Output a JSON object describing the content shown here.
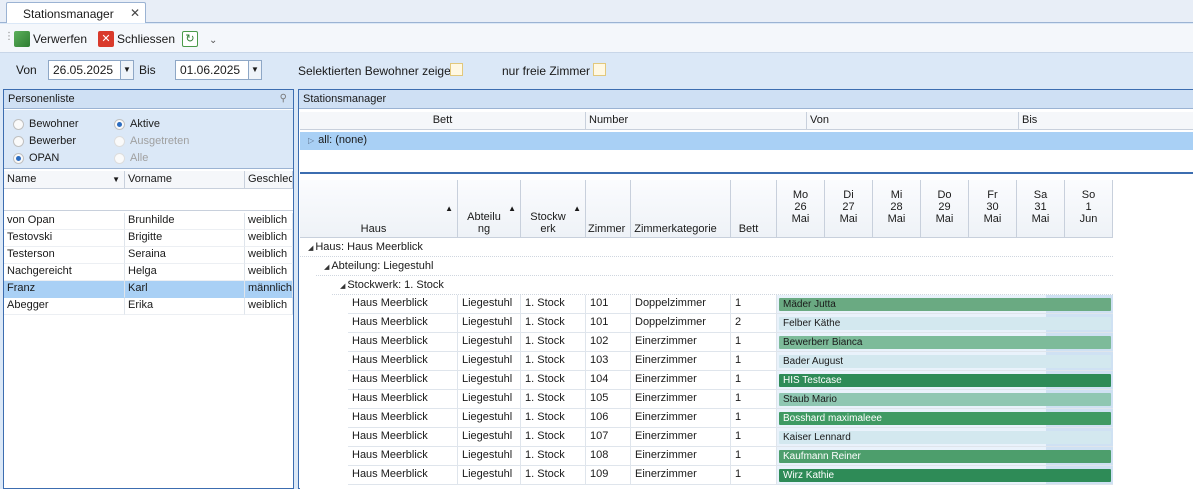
{
  "tab": {
    "title": "Stationsmanager",
    "close": "✕"
  },
  "toolbar": {
    "discard_label": "Verwerfen",
    "close_label": "Schliessen",
    "overflow": "⌄"
  },
  "filter": {
    "from_label": "Von",
    "from_value": "26.05.2025",
    "to_label": "Bis",
    "to_value": "01.06.2025",
    "selected_label": "Selektierten Bewohner zeigen",
    "free_rooms_label": "nur freie Zimmer"
  },
  "person_panel": {
    "title": "Personenliste",
    "radios": [
      {
        "label": "Bewohner",
        "selected": false,
        "enabled": true
      },
      {
        "label": "Bewerber",
        "selected": false,
        "enabled": true
      },
      {
        "label": "OPAN",
        "selected": true,
        "enabled": true
      },
      {
        "label": "Aktive",
        "selected": true,
        "enabled": true
      },
      {
        "label": "Ausgetreten",
        "selected": false,
        "enabled": false
      },
      {
        "label": "Alle",
        "selected": false,
        "enabled": false
      }
    ],
    "columns": [
      "Name",
      "Vorname",
      "Geschlec"
    ],
    "rows": [
      {
        "name": "von Opan",
        "vorname": "Brunhilde",
        "geschlecht": "weiblich"
      },
      {
        "name": "Testovski",
        "vorname": "Brigitte",
        "geschlecht": "weiblich"
      },
      {
        "name": "Testerson",
        "vorname": "Seraina",
        "geschlecht": "weiblich"
      },
      {
        "name": "Nachgereicht",
        "vorname": "Helga",
        "geschlecht": "weiblich"
      },
      {
        "name": "Franz",
        "vorname": "Karl",
        "geschlecht": "männlich"
      },
      {
        "name": "Abegger",
        "vorname": "Erika",
        "geschlecht": "weiblich"
      }
    ],
    "selected_index": 4
  },
  "station_panel": {
    "title": "Stationsmanager",
    "top_columns": [
      "Bett",
      "Number",
      "Von",
      "Bis"
    ],
    "top_group": "all:  (none)",
    "grid_columns": [
      "Haus",
      "Abteilu ng",
      "Stockw erk",
      "Zimmer",
      "Zimmerkategorie",
      "Bett"
    ],
    "days": [
      {
        "dow": "Mo",
        "day": "26",
        "mon": "Mai"
      },
      {
        "dow": "Di",
        "day": "27",
        "mon": "Mai"
      },
      {
        "dow": "Mi",
        "day": "28",
        "mon": "Mai"
      },
      {
        "dow": "Do",
        "day": "29",
        "mon": "Mai"
      },
      {
        "dow": "Fr",
        "day": "30",
        "mon": "Mai"
      },
      {
        "dow": "Sa",
        "day": "31",
        "mon": "Mai"
      },
      {
        "dow": "So",
        "day": "1",
        "mon": "Jun"
      }
    ],
    "groups": [
      "Haus:  Haus Meerblick",
      "Abteilung:  Liegestuhl",
      "Stockwerk:  1. Stock"
    ],
    "rows": [
      {
        "haus": "Haus Meerblick",
        "abteilung": "Liegestuhl",
        "stockwerk": "1. Stock",
        "zimmer": "101",
        "kategorie": "Doppelzimmer",
        "bett": "1",
        "bewohner": "Mäder Jutta",
        "color": "#6aaa82"
      },
      {
        "haus": "Haus Meerblick",
        "abteilung": "Liegestuhl",
        "stockwerk": "1. Stock",
        "zimmer": "101",
        "kategorie": "Doppelzimmer",
        "bett": "2",
        "bewohner": "Felber Käthe",
        "color": "#d3e8ef"
      },
      {
        "haus": "Haus Meerblick",
        "abteilung": "Liegestuhl",
        "stockwerk": "1. Stock",
        "zimmer": "102",
        "kategorie": "Einerzimmer",
        "bett": "1",
        "bewohner": "Bewerberr Bianca",
        "color": "#7dbb9a"
      },
      {
        "haus": "Haus Meerblick",
        "abteilung": "Liegestuhl",
        "stockwerk": "1. Stock",
        "zimmer": "103",
        "kategorie": "Einerzimmer",
        "bett": "1",
        "bewohner": "Bader August",
        "color": "#d3e8ef"
      },
      {
        "haus": "Haus Meerblick",
        "abteilung": "Liegestuhl",
        "stockwerk": "1. Stock",
        "zimmer": "104",
        "kategorie": "Einerzimmer",
        "bett": "1",
        "bewohner": "HIS Testcase",
        "color": "#2e8b57"
      },
      {
        "haus": "Haus Meerblick",
        "abteilung": "Liegestuhl",
        "stockwerk": "1. Stock",
        "zimmer": "105",
        "kategorie": "Einerzimmer",
        "bett": "1",
        "bewohner": "Staub Mario",
        "color": "#8fc7b2"
      },
      {
        "haus": "Haus Meerblick",
        "abteilung": "Liegestuhl",
        "stockwerk": "1. Stock",
        "zimmer": "106",
        "kategorie": "Einerzimmer",
        "bett": "1",
        "bewohner": "Bosshard maximaleee",
        "color": "#3f9a63"
      },
      {
        "haus": "Haus Meerblick",
        "abteilung": "Liegestuhl",
        "stockwerk": "1. Stock",
        "zimmer": "107",
        "kategorie": "Einerzimmer",
        "bett": "1",
        "bewohner": "Kaiser Lennard",
        "color": "#d3e8ef"
      },
      {
        "haus": "Haus Meerblick",
        "abteilung": "Liegestuhl",
        "stockwerk": "1. Stock",
        "zimmer": "108",
        "kategorie": "Einerzimmer",
        "bett": "1",
        "bewohner": "Kaufmann Reiner",
        "color": "#4d9e6c"
      },
      {
        "haus": "Haus Meerblick",
        "abteilung": "Liegestuhl",
        "stockwerk": "1. Stock",
        "zimmer": "109",
        "kategorie": "Einerzimmer",
        "bett": "1",
        "bewohner": "Wirz Kathie",
        "color": "#2e8b57"
      }
    ]
  }
}
